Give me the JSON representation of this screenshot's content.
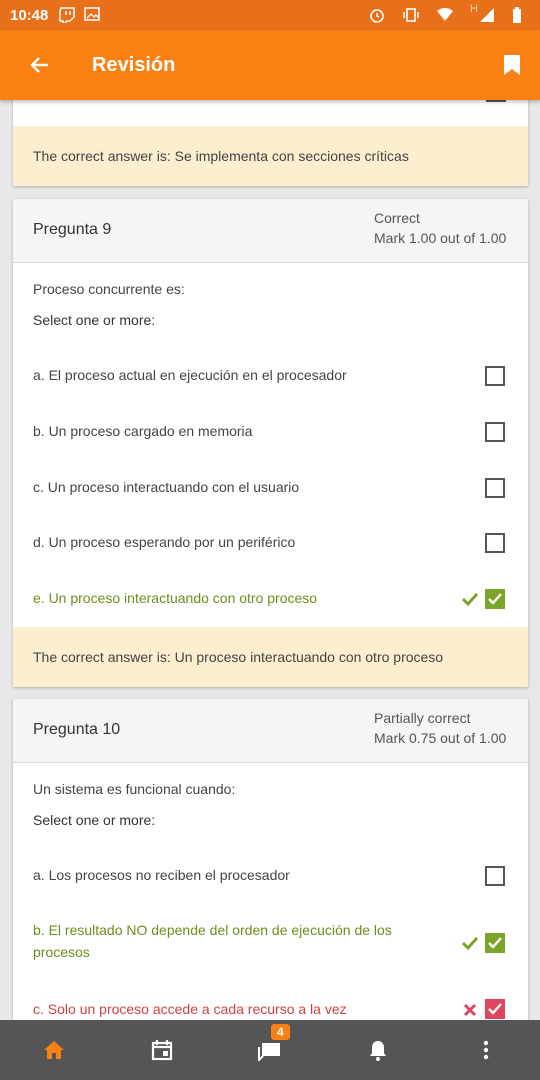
{
  "status_bar": {
    "time": "10:48",
    "icons": [
      "twitch-icon",
      "image-icon",
      "alarm-icon",
      "vibrate-icon",
      "wifi-icon",
      "signal-icon",
      "battery-icon"
    ],
    "network_label": "H"
  },
  "app_bar": {
    "title": "Revisión",
    "back_icon": "arrow-left-icon",
    "bookmark_icon": "bookmark-icon",
    "color": "#f98012"
  },
  "prev_card": {
    "feedback": "The correct answer is: Se implementa con secciones críticas"
  },
  "questions": [
    {
      "name": "Pregunta 9",
      "state": "Correct",
      "grade": "Mark 1.00 out of 1.00",
      "text": "Proceso concurrente es:",
      "prompt": "Select one or more:",
      "answers": [
        {
          "label": "a. El proceso actual en ejecución en el procesador",
          "checked": false,
          "result": "none"
        },
        {
          "label": "b. Un proceso cargado en memoria",
          "checked": false,
          "result": "none"
        },
        {
          "label": "c. Un proceso interactuando con el usuario",
          "checked": false,
          "result": "none"
        },
        {
          "label": "d. Un proceso esperando por un periférico",
          "checked": false,
          "result": "none"
        },
        {
          "label": "e. Un proceso interactuando con otro proceso",
          "checked": true,
          "result": "correct"
        }
      ],
      "feedback": "The correct answer is: Un proceso interactuando con otro proceso"
    },
    {
      "name": "Pregunta 10",
      "state": "Partially correct",
      "grade": "Mark 0.75 out of 1.00",
      "text": "Un sistema es funcional cuando:",
      "prompt": "Select one or more:",
      "answers": [
        {
          "label": "a. Los procesos no reciben el procesador",
          "checked": false,
          "result": "none"
        },
        {
          "label": "b. El resultado NO depende del orden de ejecución de los procesos",
          "checked": true,
          "result": "correct"
        },
        {
          "label": "c. Solo un proceso accede a cada recurso a la vez",
          "checked": true,
          "result": "incorrect"
        }
      ]
    }
  ],
  "bottom_nav": {
    "items": [
      "home-icon",
      "calendar-icon",
      "messages-icon",
      "notifications-icon",
      "more-icon"
    ],
    "messages_badge": "4"
  },
  "colors": {
    "accent": "#f98012",
    "correct": "#7aa52a",
    "incorrect": "#e0445f",
    "feedback_bg": "#fcefcf"
  }
}
